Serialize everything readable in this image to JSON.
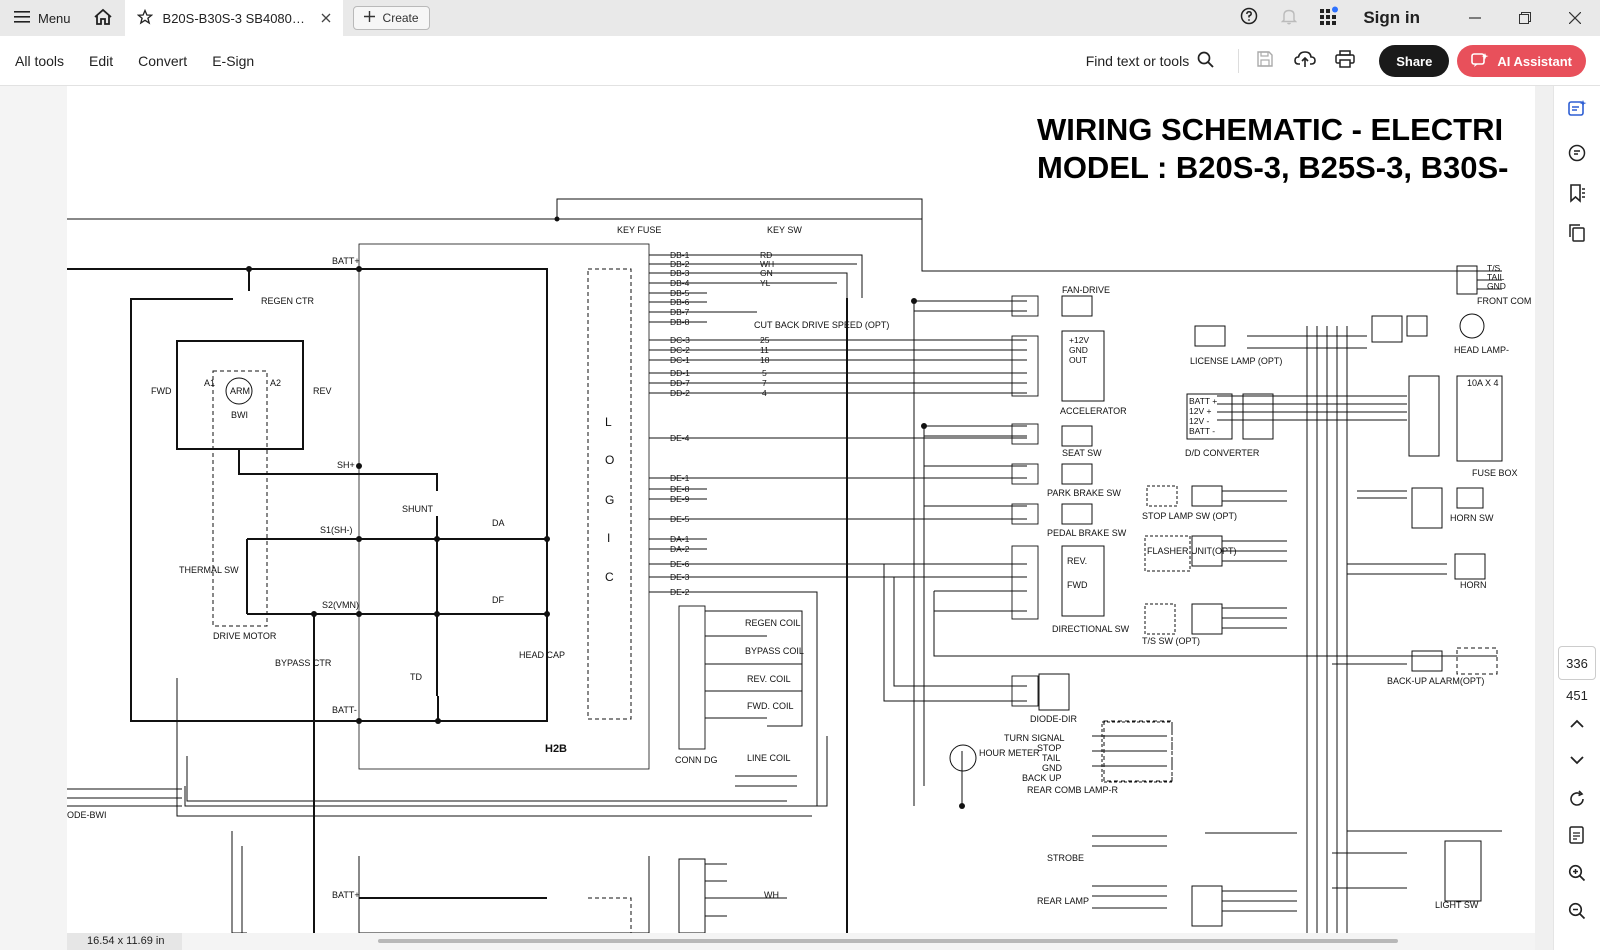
{
  "titlebar": {
    "menu_label": "Menu",
    "tab_title": "B20S-B30S-3 SB4080E0...",
    "create_label": "Create",
    "sign_in": "Sign in"
  },
  "toolbar": {
    "menu_items": [
      "All tools",
      "Edit",
      "Convert",
      "E-Sign"
    ],
    "find_placeholder": "Find text or tools",
    "share_label": "Share",
    "ai_label": "AI Assistant"
  },
  "document": {
    "title_line1": "WIRING SCHEMATIC - ELECTRI",
    "title_line2": "MODEL : B20S-3, B25S-3, B30S-",
    "page_size": "16.54 x 11.69 in",
    "labels": {
      "key_fuse": "KEY FUSE",
      "key_sw": "KEY SW",
      "batt_plus": "BATT+",
      "batt_minus": "BATT-",
      "regen_ctr": "REGEN CTR",
      "fwd": "FWD",
      "rev": "REV",
      "arm": "ARM",
      "bwi": "BWI",
      "a1": "A1",
      "a2": "A2",
      "sh_plus": "SH+",
      "shunt": "SHUNT",
      "s1": "S1(SH-)",
      "s2": "S2(VMN)",
      "da": "DA",
      "df": "DF",
      "td": "TD",
      "head_cap": "HEAD CAP",
      "thermal_sw": "THERMAL SW",
      "drive_motor": "DRIVE MOTOR",
      "bypass_ctr": "BYPASS CTR",
      "h2b": "H2B",
      "conn_dg": "CONN DG",
      "logic": [
        "L",
        "O",
        "G",
        "I",
        "C"
      ],
      "db_pins": [
        "DB-1",
        "DB-2",
        "DB-3",
        "DB-4",
        "DB-5",
        "DB-6",
        "DB-7",
        "DB-8"
      ],
      "db_colors": [
        "RD",
        "WH",
        "GN",
        "YL"
      ],
      "dc_pins": [
        "DC-3",
        "DC-2",
        "DC-1",
        "DD-1",
        "DD-7",
        "DD-2"
      ],
      "dc_wires": [
        "25",
        "11",
        "18",
        "5",
        "7",
        "4"
      ],
      "de_pins": [
        "DE-4",
        "DE-1",
        "DE-8",
        "DE-9",
        "DE-5",
        "DA-1",
        "DA-2",
        "DE-6",
        "DE-3",
        "DE-2"
      ],
      "cut_back": "CUT BACK DRIVE SPEED (OPT)",
      "fan_drive": "FAN-DRIVE",
      "accelerator": "ACCELERATOR",
      "acc_box": [
        "+12V",
        "GND",
        "OUT"
      ],
      "seat_sw": "SEAT SW",
      "park_brake_sw": "PARK BRAKE SW",
      "pedal_brake_sw": "PEDAL BRAKE SW",
      "directional_sw": "DIRECTIONAL SW",
      "dir_rev": "REV.",
      "dir_fwd": "FWD",
      "diode_dir": "DIODE-DIR",
      "hour_meter": "HOUR METER",
      "regen_coil": "REGEN COIL",
      "bypass_coil": "BYPASS COIL",
      "rev_coil": "REV. COIL",
      "fwd_coil": "FWD. COIL",
      "line_coil": "LINE COIL",
      "turn_signal": "TURN SIGNAL",
      "stop": "STOP",
      "tail": "TAIL",
      "gnd": "GND",
      "back_up": "BACK UP",
      "rear_comb_lamp": "REAR COMB LAMP-R",
      "strobe": "STROBE",
      "rear_lamp": "REAR LAMP",
      "license_lamp": "LICENSE LAMP (OPT)",
      "dd_converter": "D/D CONVERTER",
      "dd_box": [
        "BATT +",
        "12V +",
        "12V -",
        "BATT -"
      ],
      "stop_lamp_sw": "STOP LAMP SW (OPT)",
      "flasher_unit": "FLASHER UNIT(OPT)",
      "ts_sw": "T/S SW (OPT)",
      "fuse_box": "FUSE BOX",
      "fuse_rating": "10A X 4",
      "horn_sw": "HORN SW",
      "horn": "HORN",
      "backup_alarm": "BACK-UP ALARM(OPT)",
      "light_sw": "LIGHT SW",
      "head_lamp": "HEAD LAMP-",
      "front_com": "FRONT COM",
      "ts_tail_gnd": [
        "T/S",
        "TAIL",
        "GND"
      ],
      "diode_bwi": "ODE-BWI",
      "batt_plus_2": "BATT+",
      "wh": "WH"
    }
  },
  "rail": {
    "page_current": "336",
    "page_total": "451"
  },
  "colors": {
    "accent": "#e8505b",
    "share_bg": "#1a1a1a",
    "rail_icon": "#2e5fd4"
  }
}
